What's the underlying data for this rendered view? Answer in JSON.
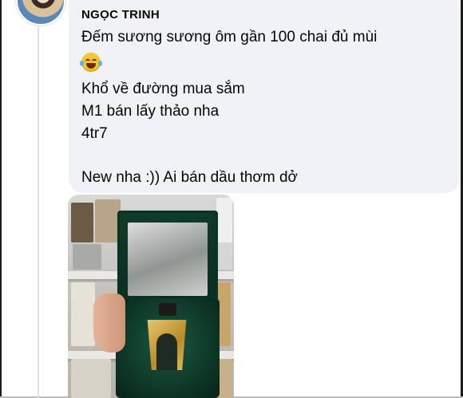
{
  "post": {
    "author": "NGỌC TRINH",
    "lines": [
      "Đếm sương sương ôm gần 100 chai đủ mùi",
      "Khổ về đường mua sắm",
      "M1 bán lấy thảo nha",
      "4tr7",
      "New nha :)) Ai bán dầu thơm dở"
    ],
    "emoji": "face-with-tears-of-joy"
  },
  "colors": {
    "bubble": "#f0f2f5",
    "text": "#050505",
    "frame": "#1c1c1c"
  }
}
